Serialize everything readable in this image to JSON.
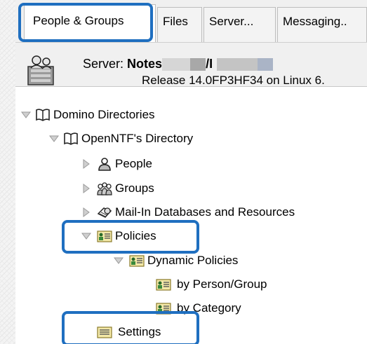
{
  "tabs": [
    {
      "label": "People & Groups",
      "active": true
    },
    {
      "label": "Files",
      "active": false
    },
    {
      "label": "Server...",
      "active": false
    },
    {
      "label": "Messaging..",
      "active": false
    }
  ],
  "server": {
    "label": "Server:",
    "name_visible": "Notes",
    "name_suffix": "/I",
    "release": "Release 14.0FP3HF34 on Linux 6."
  },
  "tree": {
    "root": {
      "label": "Domino Directories",
      "icon": "book-icon",
      "expanded": true
    },
    "directory": {
      "label": "OpenNTF's Directory",
      "icon": "book-icon",
      "expanded": true
    },
    "people": {
      "label": "People",
      "icon": "person-icon",
      "expanded": false
    },
    "groups": {
      "label": "Groups",
      "icon": "group-icon",
      "expanded": false
    },
    "mailin": {
      "label": "Mail-In Databases and Resources",
      "icon": "mailin-icon",
      "expanded": false
    },
    "policies": {
      "label": "Policies",
      "icon": "policy-icon",
      "expanded": true
    },
    "dynamic": {
      "label": "Dynamic Policies",
      "icon": "policy-icon",
      "expanded": true
    },
    "by_person": {
      "label": "by Person/Group",
      "icon": "policy-icon"
    },
    "by_category": {
      "label": "by Category",
      "icon": "policy-icon"
    },
    "settings": {
      "label": "Settings",
      "icon": "settings-icon"
    }
  },
  "colors": {
    "highlight": "#1f6fc0",
    "tab_bg": "#f0f0f0",
    "tree_bg": "#ffffff"
  }
}
